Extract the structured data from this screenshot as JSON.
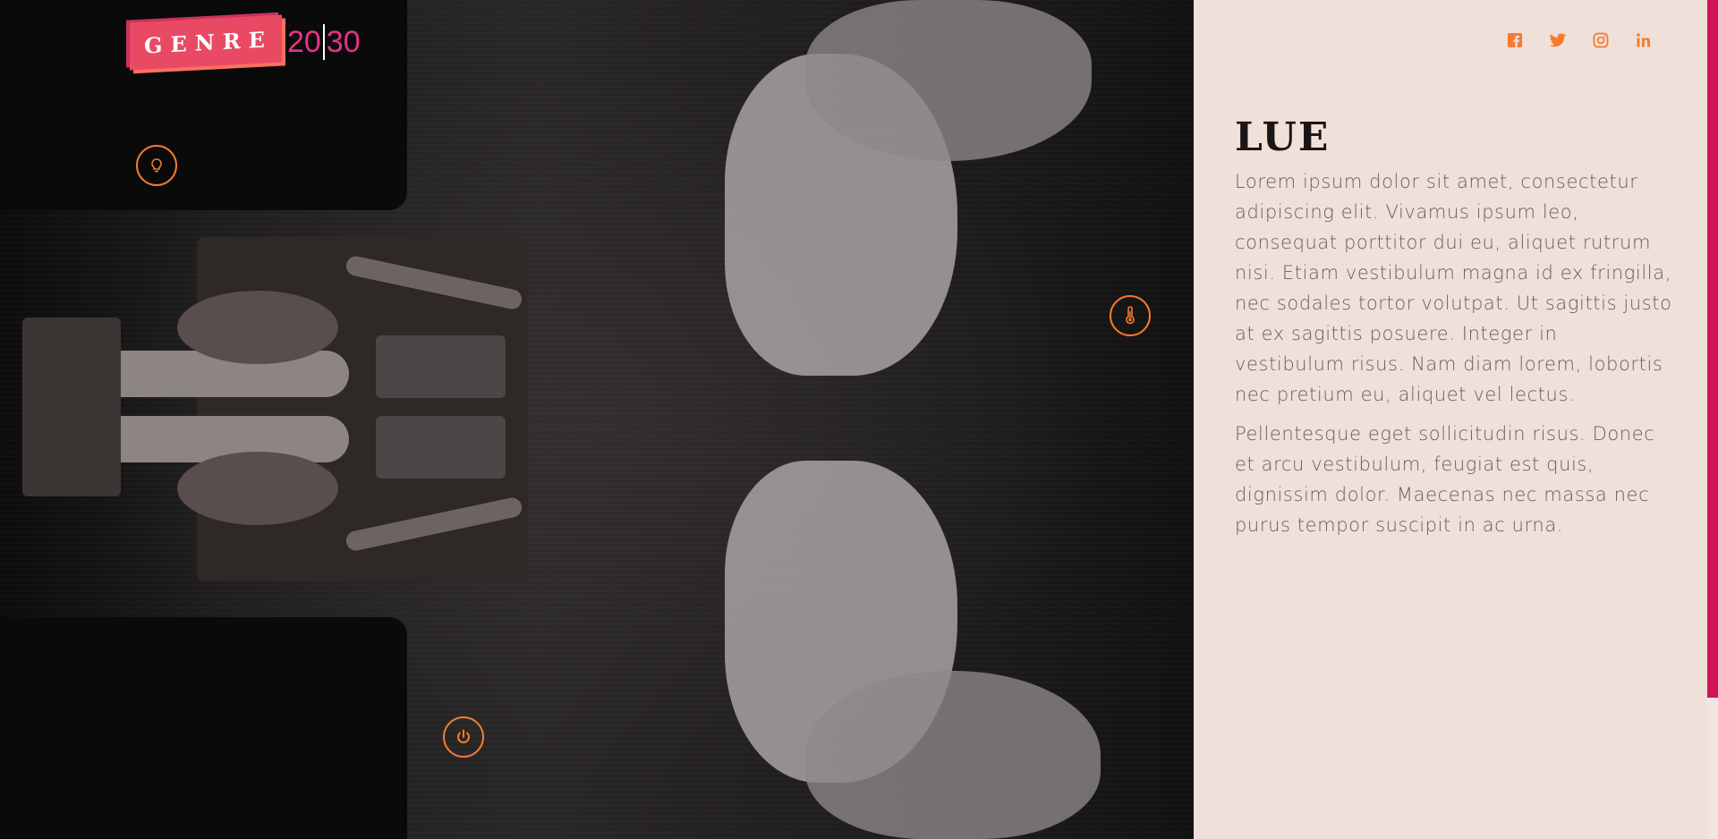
{
  "brand": {
    "logo_word": "GENRE",
    "logo_year_left": "20",
    "logo_year_right": "30",
    "colors": {
      "primary": "#e94a63",
      "accent": "#f57b2f",
      "magenta": "#d4145a",
      "panel_bg": "#efe0d9"
    }
  },
  "hotspots": [
    {
      "icon": "lightbulb-icon"
    },
    {
      "icon": "thermometer-icon"
    },
    {
      "icon": "power-icon"
    }
  ],
  "social": [
    {
      "icon": "facebook-icon",
      "label": "f"
    },
    {
      "icon": "twitter-icon"
    },
    {
      "icon": "instagram-icon"
    },
    {
      "icon": "linkedin-icon",
      "label": "in"
    }
  ],
  "content": {
    "title": "LUE",
    "paragraph1": "Lorem ipsum dolor sit amet, consectetur adipiscing elit. Vivamus ipsum leo, consequat porttitor dui eu, aliquet rutrum nisi. Etiam vestibulum magna id ex fringilla, nec sodales tortor volutpat. Ut sagittis justo at ex sagittis posuere. Integer in vestibulum risus. Nam diam lorem, lobortis nec pretium eu, aliquet vel lectus.",
    "paragraph2": "Pellentesque eget sollicitudin risus. Donec et arcu vestibulum, feugiat est quis, dignissim dolor. Maecenas nec massa nec purus tempor suscipit in ac urna."
  }
}
